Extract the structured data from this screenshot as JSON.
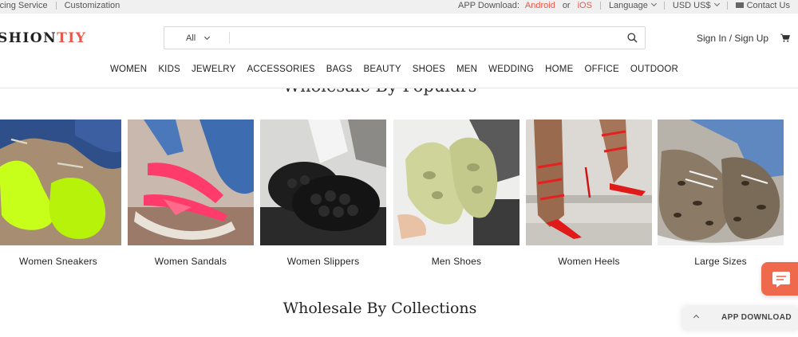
{
  "topbar": {
    "sourcing_service": "rcing Service",
    "customization": "Customization",
    "app_download_label": "APP Download:",
    "android": "Android",
    "or": "or",
    "ios": "iOS",
    "language": "Language",
    "currency": "USD US$",
    "contact": "Contact Us"
  },
  "header": {
    "logo_part1": "SHION",
    "logo_part2": "TIY",
    "search_category": "All",
    "search_placeholder": "",
    "signin": "Sign In / Sign Up"
  },
  "nav": {
    "items": [
      "WOMEN",
      "KIDS",
      "JEWELRY",
      "ACCESSORIES",
      "BAGS",
      "BEAUTY",
      "SHOES",
      "MEN",
      "WEDDING",
      "HOME",
      "OFFICE",
      "OUTDOOR"
    ]
  },
  "sections": {
    "popular_title": "Wholesale By Populars",
    "collections_title": "Wholesale By Collections"
  },
  "products": [
    {
      "label": "Women Sneakers"
    },
    {
      "label": "Women Sandals"
    },
    {
      "label": "Women Slippers"
    },
    {
      "label": "Men Shoes"
    },
    {
      "label": "Women Heels"
    },
    {
      "label": "Large Sizes"
    }
  ],
  "widgets": {
    "app_download": "APP DOWNLOAD"
  },
  "colors": {
    "accent": "#e8584b",
    "chat_button": "#ef6a4c"
  }
}
